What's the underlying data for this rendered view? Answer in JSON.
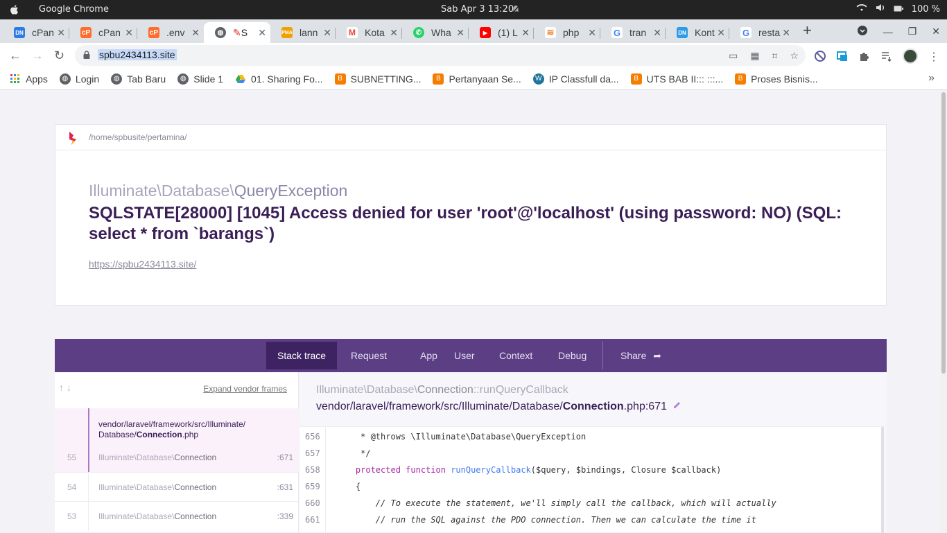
{
  "os": {
    "app_name": "Google Chrome",
    "clock": "Sab Apr 3  13:20",
    "battery": "100 %"
  },
  "tabs": [
    {
      "title": "cPan",
      "icon": "dn-icon",
      "color": "#2d7be5"
    },
    {
      "title": "cPan",
      "icon": "cpanel-icon",
      "color": "#ff6c2c"
    },
    {
      "title": ".env",
      "icon": "cpanel-icon",
      "color": "#ff6c2c"
    },
    {
      "title": "S",
      "icon": "globe-icon",
      "color": "#5f6368",
      "active": true
    },
    {
      "title": "lann",
      "icon": "pma-icon",
      "color": "#f0a000"
    },
    {
      "title": "Kota",
      "icon": "gmail-icon",
      "color": "#ea4335"
    },
    {
      "title": "Wha",
      "icon": "whatsapp-icon",
      "color": "#25d366"
    },
    {
      "title": "(1) L",
      "icon": "youtube-icon",
      "color": "#ff0000"
    },
    {
      "title": "php",
      "icon": "stackoverflow-icon",
      "color": "#f48024"
    },
    {
      "title": "tran",
      "icon": "google-icon",
      "color": "#4285f4"
    },
    {
      "title": "Kont",
      "icon": "dn-icon",
      "color": "#2d9be5"
    },
    {
      "title": "resta",
      "icon": "google-icon",
      "color": "#4285f4"
    }
  ],
  "toolbar": {
    "url": "spbu2434113.site"
  },
  "bookmarks": [
    {
      "label": "Apps",
      "icon": "apps-grid-icon"
    },
    {
      "label": "Login",
      "icon": "globe-icon"
    },
    {
      "label": "Tab Baru",
      "icon": "globe-icon"
    },
    {
      "label": "Slide 1",
      "icon": "globe-icon"
    },
    {
      "label": "01. Sharing Fo...",
      "icon": "drive-icon"
    },
    {
      "label": "SUBNETTING...",
      "icon": "blogger-icon"
    },
    {
      "label": "Pertanyaan Se...",
      "icon": "blogger-icon"
    },
    {
      "label": "IP Classfull da...",
      "icon": "wordpress-icon"
    },
    {
      "label": "UTS BAB II::: :::...",
      "icon": "blogger-icon"
    },
    {
      "label": "Proses Bisnis...",
      "icon": "blogger-icon"
    }
  ],
  "error": {
    "path": "/home/spbusite/pertamina/",
    "namespace": "Illuminate\\Database\\",
    "exception": "QueryException",
    "message": "SQLSTATE[28000] [1045] Access denied for user 'root'@'localhost' (using password: NO) (SQL: select * from `barangs`)",
    "url": "https://spbu2434113.site/"
  },
  "ignition_tabs": {
    "stack_trace": "Stack trace",
    "request": "Request",
    "app": "App",
    "user": "User",
    "context": "Context",
    "debug": "Debug",
    "share": "Share"
  },
  "frames": {
    "expand_label": "Expand vendor frames",
    "active_file_dir": "vendor/laravel/framework/src/Illuminate/",
    "active_file_sub": "Database/",
    "active_file_name": "Connection",
    "active_file_ext": ".php",
    "rows": [
      {
        "num": "55",
        "ns": "Illuminate\\Database\\",
        "cls": "Connection",
        "line": ":671"
      },
      {
        "num": "54",
        "ns": "Illuminate\\Database\\",
        "cls": "Connection",
        "line": ":631"
      },
      {
        "num": "53",
        "ns": "Illuminate\\Database\\",
        "cls": "Connection",
        "line": ":339"
      }
    ]
  },
  "detail": {
    "method_ns": "Illuminate\\Database\\",
    "method_cls": "Connection",
    "method_name": "::runQueryCallback",
    "file_dir": "vendor/laravel/framework/src/Illuminate/Database/",
    "file_name": "Connection",
    "file_ext": ".php:671"
  },
  "code": [
    {
      "n": "656",
      "text": "     * @throws \\Illuminate\\Database\\QueryException"
    },
    {
      "n": "657",
      "text": "     */"
    },
    {
      "n": "658",
      "kw": "protected function ",
      "fn": "runQueryCallback",
      "rest": "($query, $bindings, Closure $callback)"
    },
    {
      "n": "659",
      "text": "    {"
    },
    {
      "n": "660",
      "comment": "        // To execute the statement, we'll simply call the callback, which will actually"
    },
    {
      "n": "661",
      "comment": "        // run the SQL against the PDO connection. Then we can calculate the time it"
    }
  ]
}
